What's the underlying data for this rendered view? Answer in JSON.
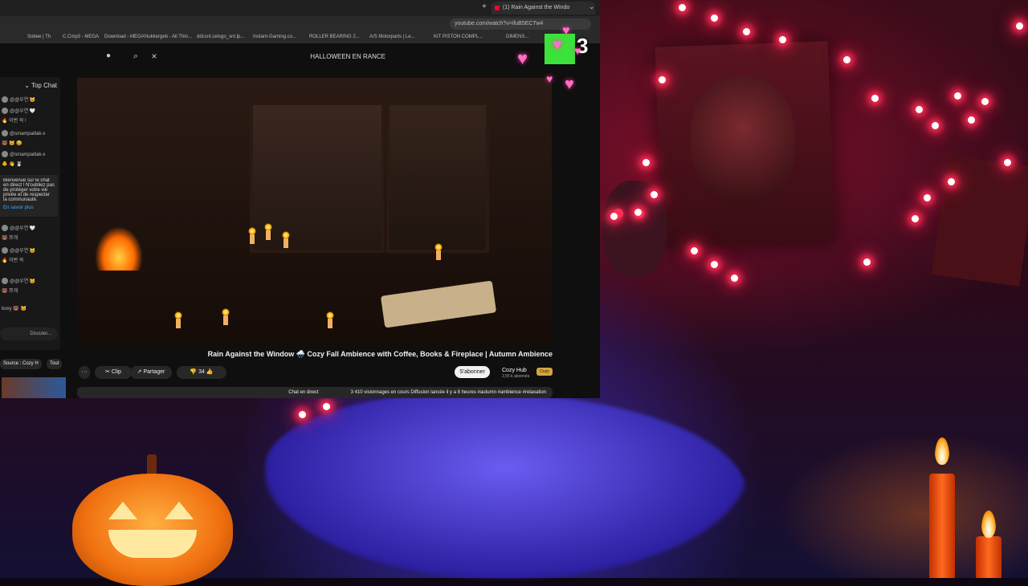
{
  "browser": {
    "tab_title": "(1) Rain Against the Windo",
    "url": "youtube.com/watch?v=ifuB5ECTw4",
    "bookmarks": [
      "Sobee | Th",
      "C.Cmp3 - MEGA",
      "Download - MEGA",
      "Nukkergeb - All Thin...",
      "ddcsnt.celsgo_snt.lp...",
      "Instant-Gaming.co...",
      "ROLLER BEARING 2...",
      "A/S Motorparts | Le...",
      "KIT PISTON COMPL...",
      "DIMENS..."
    ]
  },
  "youtube": {
    "search_query": "HALLOWEEN EN RANCE",
    "video_title": "Rain Against the Window 🌧️ Cozy Fall Ambience with Coffee, Books & Fireplace | Autumn Ambience",
    "channel_name": "Cozy Hub",
    "channel_subs": "2,55 k abonnés",
    "channel_badge": "Cozy",
    "subscribe_label": "S'abonner",
    "like_count": "34",
    "share_label": "Partager",
    "clip_label": "Clip",
    "more_label": "···",
    "description": "3 410 visionnages en cours  Diffusion lancée il y a 8 heures  #autumn #ambience #relaxation",
    "live_chat_label": "Chat en direct",
    "chips": [
      "Tout",
      "Source : Cozy H"
    ]
  },
  "chat": {
    "header": "Top Chat",
    "lines": [
      "@@우연 🐱",
      "@@우연 🤍",
      "🔥 이번 꼭 !",
      "@smampaillak-x",
      "🐻 🐱 😂",
      "@smampaillak-x",
      "🐥 👋 🐰"
    ],
    "pinned_text": "Bienvenue sur le chat en direct ! N'oubliez pas de protéger votre vie privée et de respecter la communauté.",
    "pinned_more": "En savoir plus",
    "more_lines": [
      "@@우연 🤍",
      "🐻 쪼개",
      "@@우연 🐱",
      "🔥 이번 꼭",
      "@@우연 🐱",
      "🐻 쪼개",
      "boxy 🐻 🐱"
    ],
    "input_placeholder": "Discuter..."
  },
  "overlay": {
    "counter": "3"
  }
}
